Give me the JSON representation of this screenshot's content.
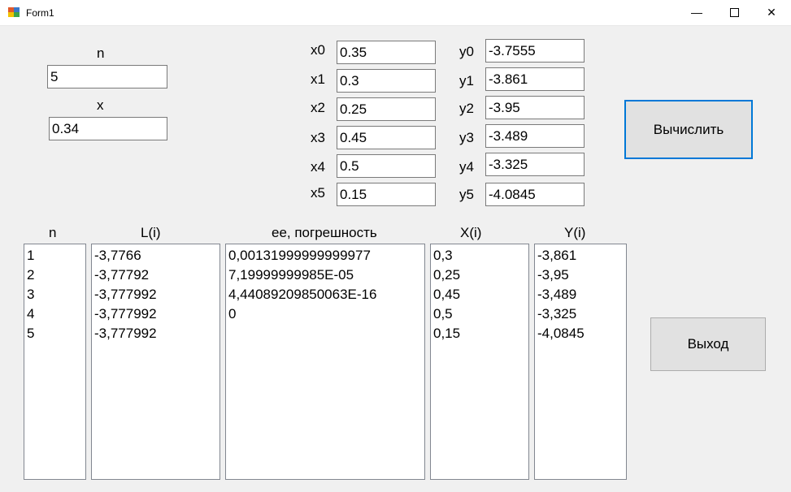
{
  "window": {
    "title": "Form1"
  },
  "inputs": {
    "n_label": "n",
    "n_value": "5",
    "x_label": "x",
    "x_value": "0.34",
    "xs": [
      {
        "label": "x0",
        "value": "0.35"
      },
      {
        "label": "x1",
        "value": "0.3"
      },
      {
        "label": "x2",
        "value": "0.25"
      },
      {
        "label": "x3",
        "value": "0.45"
      },
      {
        "label": "x4",
        "value": "0.5"
      },
      {
        "label": "x5",
        "value": "0.15"
      }
    ],
    "ys": [
      {
        "label": "y0",
        "value": "-3.7555"
      },
      {
        "label": "y1",
        "value": "-3.861"
      },
      {
        "label": "y2",
        "value": "-3.95"
      },
      {
        "label": "y3",
        "value": "-3.489"
      },
      {
        "label": "y4",
        "value": "-3.325"
      },
      {
        "label": "y5",
        "value": "-4.0845"
      }
    ]
  },
  "buttons": {
    "compute": "Вычислить",
    "exit": "Выход"
  },
  "lists": {
    "n": {
      "header": "n",
      "items": [
        "1",
        "2",
        "3",
        "4",
        "5"
      ]
    },
    "L": {
      "header": "L(i)",
      "items": [
        "-3,7766",
        "-3,77792",
        "-3,777992",
        "-3,777992",
        "-3,777992"
      ]
    },
    "ee": {
      "header": "ee, погрешность",
      "items": [
        "0,00131999999999977",
        "7,19999999985E-05",
        "4,44089209850063E-16",
        "0"
      ]
    },
    "X": {
      "header": "X(i)",
      "items": [
        "0,3",
        "0,25",
        "0,45",
        "0,5",
        "0,15"
      ]
    },
    "Y": {
      "header": "Y(i)",
      "items": [
        "-3,861",
        "-3,95",
        "-3,489",
        "-3,325",
        "-4,0845"
      ]
    }
  }
}
